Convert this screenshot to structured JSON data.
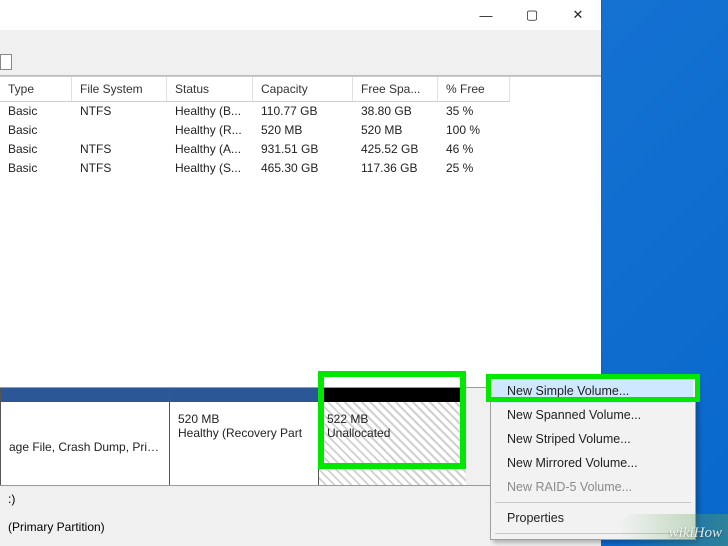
{
  "titlebar": {
    "min": "—",
    "max": "▢",
    "close": "✕"
  },
  "columns": {
    "type": "Type",
    "fs": "File System",
    "status": "Status",
    "cap": "Capacity",
    "free": "Free Spa...",
    "pct": "% Free"
  },
  "volumes": [
    {
      "type": "Basic",
      "fs": "NTFS",
      "status": "Healthy (B...",
      "cap": "110.77 GB",
      "free": "38.80 GB",
      "pct": "35 %"
    },
    {
      "type": "Basic",
      "fs": "",
      "status": "Healthy (R...",
      "cap": "520 MB",
      "free": "520 MB",
      "pct": "100 %"
    },
    {
      "type": "Basic",
      "fs": "NTFS",
      "status": "Healthy (A...",
      "cap": "931.51 GB",
      "free": "425.52 GB",
      "pct": "46 %"
    },
    {
      "type": "Basic",
      "fs": "NTFS",
      "status": "Healthy (S...",
      "cap": "465.30 GB",
      "free": "117.36 GB",
      "pct": "25 %"
    }
  ],
  "graph": {
    "vol_a": {
      "line1": "",
      "line2": "age File, Crash Dump, Primar"
    },
    "vol_b": {
      "line1": "520 MB",
      "line2": "Healthy (Recovery Part"
    },
    "vol_c": {
      "line1": "522 MB",
      "line2": "Unallocated"
    }
  },
  "disk_info": {
    "line1": ":)",
    "line2": "",
    "line3": "(Primary Partition)"
  },
  "menu": {
    "new_simple": "New Simple Volume...",
    "new_spanned": "New Spanned Volume...",
    "new_striped": "New Striped Volume...",
    "new_mirrored": "New Mirrored Volume...",
    "new_raid5": "New RAID-5 Volume...",
    "properties": "Properties"
  },
  "watermark": "wikiHow"
}
